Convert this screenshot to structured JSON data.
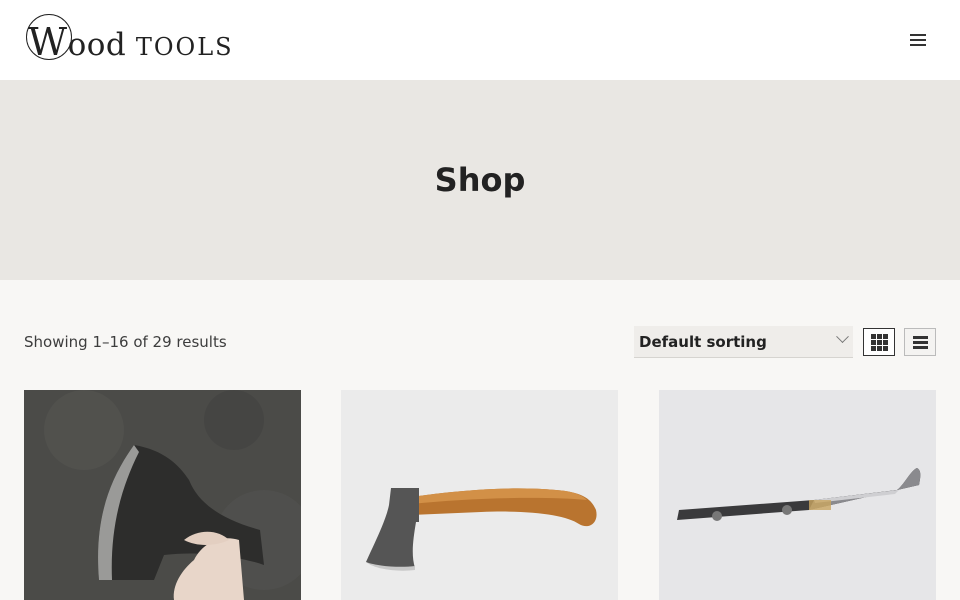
{
  "header": {
    "logo_text_big": "W",
    "logo_text_rest": "ood",
    "logo_text_second": " TOOLS",
    "menu_icon": "hamburger-menu-icon"
  },
  "hero": {
    "title": "Shop"
  },
  "toolbar": {
    "result_count": "Showing 1–16 of 29 results",
    "sort_label": "Default sorting",
    "grid_view_icon": "grid-view-icon",
    "list_view_icon": "list-view-icon"
  },
  "products": [
    {
      "image_subject": "hand forged axe head held in hand"
    },
    {
      "image_subject": "small hatchet with wooden handle"
    },
    {
      "image_subject": "curved carving knife blade"
    }
  ],
  "colors": {
    "header_bg": "#ffffff",
    "hero_bg": "#e9e7e3",
    "page_bg": "#f8f7f5",
    "text": "#222222"
  }
}
